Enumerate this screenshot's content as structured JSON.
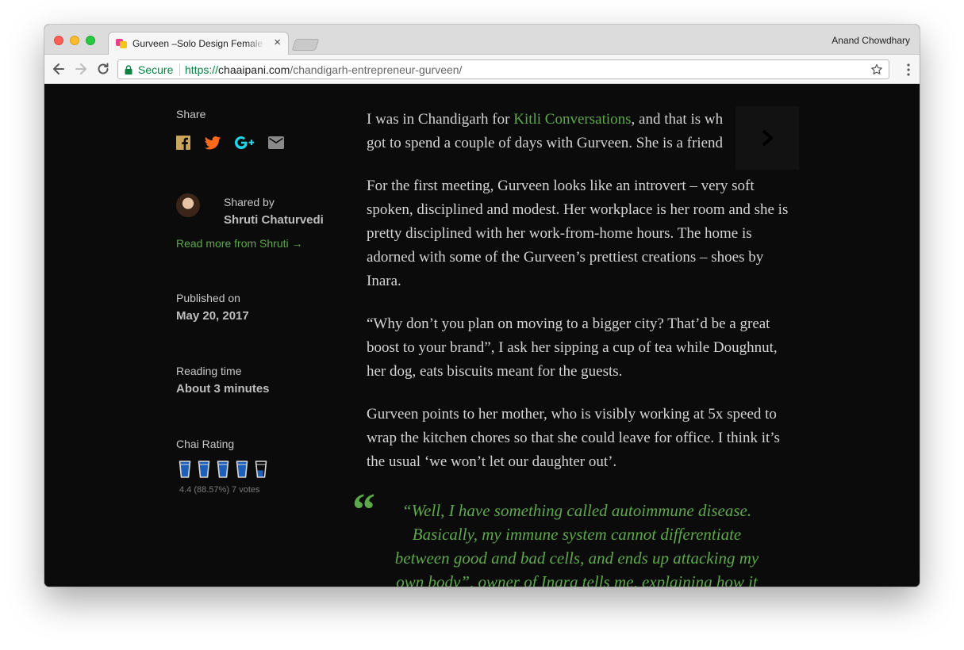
{
  "browser": {
    "tab_title": "Gurveen –Solo Design Female",
    "tab_close": "×",
    "profile_name": "Anand Chowdhary",
    "address": {
      "secure_label": "Secure",
      "scheme": "https://",
      "host": "chaaipani.com",
      "path": "/chandigarh-entrepreneur-gurveen/"
    }
  },
  "sidebar": {
    "share_label": "Share",
    "share_icons": [
      "facebook-icon",
      "twitter-icon",
      "google-plus-icon",
      "email-icon"
    ],
    "shared_by_label": "Shared by",
    "author_name": "Shruti Chaturvedi",
    "read_more": "Read more from Shruti →",
    "published_label": "Published on",
    "published_date": "May 20, 2017",
    "reading_label": "Reading time",
    "reading_value": "About 3 minutes",
    "chai_label": "Chai Rating",
    "rating_text": "4.4 (88.57%) 7 votes",
    "rating_fraction": 0.8857
  },
  "article": {
    "p1_before": "I was in Chandigarh for ",
    "p1_link": "Kitli Conversations",
    "p1_after": ", and that is wh",
    "p1_line2": "got to spend a couple of days with Gurveen. She is a friend",
    "p2": "For the first meeting, Gurveen looks like an introvert – very soft spoken, disciplined and modest. Her workplace is her room and she is pretty disciplined with her work-from-home hours. The home is adorned with some of the Gurveen’s prettiest creations – shoes by Inara.",
    "p3": "“Why don’t you plan on moving to a bigger city? That’d be a great boost to your brand”, I ask her sipping a cup of tea while Doughnut, her dog, eats biscuits meant for the guests.",
    "p4": "Gurveen points to her mother, who is visibly working at 5x speed to wrap the kitchen chores so that she could leave for office. I think it’s the usual ‘we won’t let our daughter out’.",
    "quote_mark": "“",
    "pull_quote": "“Well, I have something called autoimmune disease. Basically, my immune system cannot differentiate between good and bad cells, and ends up attacking my own body”, owner of Inara tells me, explaining how it"
  },
  "colors": {
    "accent_green": "#5da84b",
    "page_bg": "#0b0b0b",
    "twitter": "#ff6a1a",
    "google_plus": "#21d4e8",
    "facebook": "#c9a45a"
  }
}
